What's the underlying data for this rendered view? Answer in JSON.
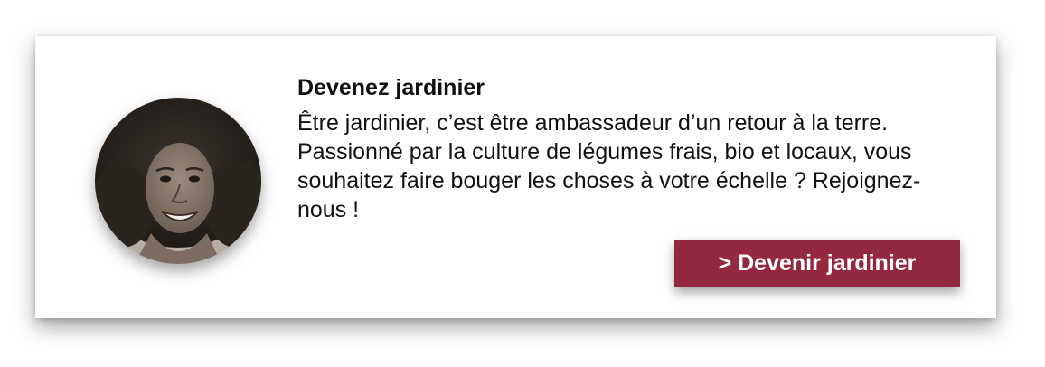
{
  "card": {
    "title": "Devenez jardinier",
    "description": "Être jardinier, c’est être ambassadeur d’un retour à la terre. Passionné par la culture de légumes frais, bio et locaux, vous souhaitez faire bouger les choses à votre échelle ? Rejoignez-nous !",
    "cta_label": "> Devenir jardinier"
  },
  "colors": {
    "cta_background": "#94283e",
    "cta_text": "#ffffff",
    "text": "#111111",
    "card_background": "#ffffff"
  }
}
